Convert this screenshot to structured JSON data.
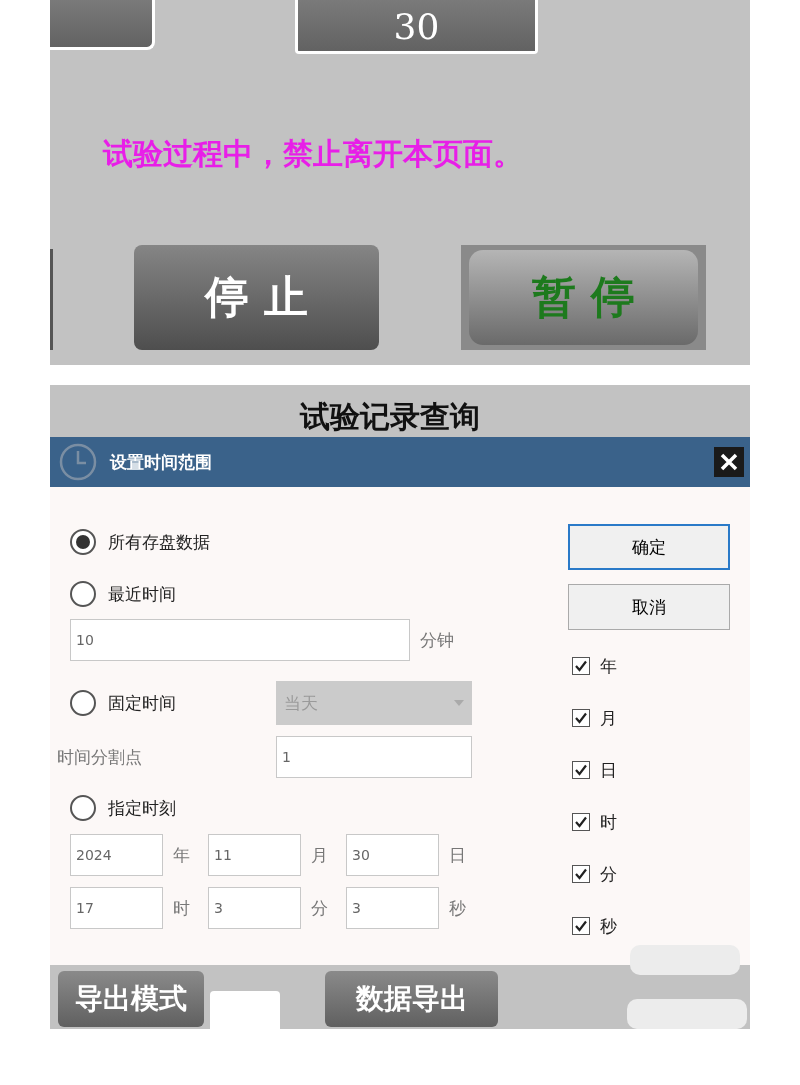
{
  "run_panel": {
    "value_button": "30",
    "warning": "试验过程中，禁止离开本页面。",
    "buttons": [
      {
        "label": "停 止",
        "kind": "stop"
      },
      {
        "label": "暂 停",
        "kind": "pause"
      }
    ]
  },
  "query_page": {
    "title": "试验记录查询",
    "dialog": {
      "title": "设置时间范围",
      "time_modes": [
        {
          "label": "所有存盘数据",
          "selected": true
        },
        {
          "label": "最近时间",
          "selected": false
        },
        {
          "label": "固定时间",
          "selected": false
        },
        {
          "label": "指定时刻",
          "selected": false
        }
      ],
      "recent_minutes": {
        "value": "10",
        "unit": "分钟"
      },
      "fixed_range": {
        "value": "当天",
        "disabled": true
      },
      "split_point": {
        "label": "时间分割点",
        "value": "1"
      },
      "date_parts": [
        {
          "value": "2024",
          "unit": "年"
        },
        {
          "value": "11",
          "unit": "月"
        },
        {
          "value": "30",
          "unit": "日"
        },
        {
          "value": "17",
          "unit": "时"
        },
        {
          "value": "3",
          "unit": "分"
        },
        {
          "value": "3",
          "unit": "秒"
        }
      ],
      "buttons": [
        {
          "label": "确定",
          "default": true
        },
        {
          "label": "取消",
          "default": false
        }
      ],
      "checkboxes": [
        {
          "label": "年",
          "checked": true
        },
        {
          "label": "月",
          "checked": true
        },
        {
          "label": "日",
          "checked": true
        },
        {
          "label": "时",
          "checked": true
        },
        {
          "label": "分",
          "checked": true
        },
        {
          "label": "秒",
          "checked": true
        }
      ]
    },
    "bottom_buttons": [
      {
        "label": "导出模式"
      },
      {
        "label": "数据导出"
      }
    ]
  }
}
